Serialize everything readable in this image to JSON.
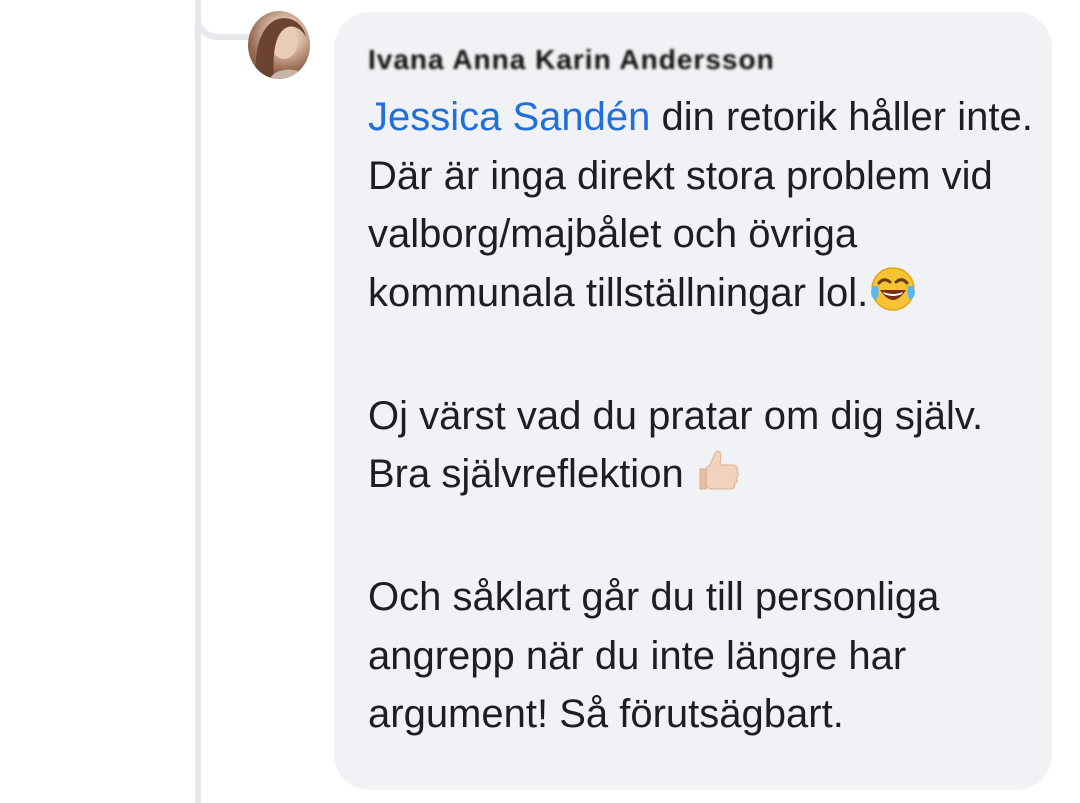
{
  "comment": {
    "author_name": "Ivana Anna Karin Andersson",
    "mention": "Jessica Sandén",
    "paragraphs": [
      {
        "text": " din retorik håller inte. Där är inga direkt stora problem vid valborg/majbålet och övriga kommunala tillställningar lol.",
        "emoji": "face-with-tears-of-joy-icon"
      },
      {
        "text": "Oj värst vad du pratar om dig själv. Bra självreflektion ",
        "emoji": "thumbs-up-icon"
      },
      {
        "text": "Och såklart går du till personliga angrepp när du inte längre har argument! Så förutsägbart."
      }
    ]
  },
  "colors": {
    "bubble_bg": "#f0f2f5",
    "mention": "#216fdb",
    "text": "#1c1e21",
    "thread_line": "#e6e8ec"
  }
}
